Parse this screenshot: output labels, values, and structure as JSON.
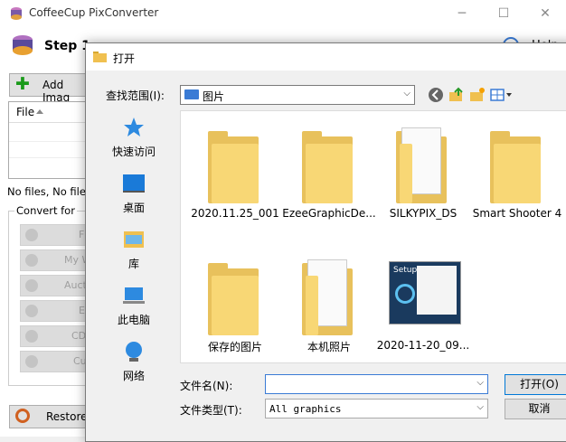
{
  "app": {
    "title": "CoffeeCup PixConverter",
    "window_controls": [
      "minimize",
      "maximize",
      "close"
    ]
  },
  "main": {
    "step_text": "Step 1",
    "help_label": "Help",
    "add_images_label": "Add Imag",
    "file_column_header": "File",
    "no_files_text": "No files, No files s",
    "convert_for_label": "Convert for",
    "convert_buttons": [
      {
        "label": "F",
        "icon": "film-icon"
      },
      {
        "label": "My W",
        "icon": "web-icon"
      },
      {
        "label": "Auct",
        "icon": "auction-icon"
      },
      {
        "label": "E",
        "icon": "email-icon"
      },
      {
        "label": "CD",
        "icon": "cd-icon"
      },
      {
        "label": "Cu",
        "icon": "custom-icon"
      }
    ],
    "restore_label": "Restore"
  },
  "dialog": {
    "title": "打开",
    "lookin_label": "查找范围(I):",
    "lookin_value": "图片",
    "places": [
      {
        "label": "快速访问",
        "icon": "quick-access-icon"
      },
      {
        "label": "桌面",
        "icon": "desktop-icon"
      },
      {
        "label": "库",
        "icon": "library-icon"
      },
      {
        "label": "此电脑",
        "icon": "this-pc-icon"
      },
      {
        "label": "网络",
        "icon": "network-icon"
      }
    ],
    "files": [
      {
        "name": "2020.11.25_001",
        "kind": "folder"
      },
      {
        "name": "EzeeGraphicDe...",
        "kind": "folder"
      },
      {
        "name": "SILKYPIX_DS",
        "kind": "folder-doc"
      },
      {
        "name": "Smart Shooter 4",
        "kind": "folder"
      },
      {
        "name": "保存的图片",
        "kind": "folder"
      },
      {
        "name": "本机照片",
        "kind": "folder-doc"
      },
      {
        "name": "2020-11-20_09...",
        "kind": "image"
      }
    ],
    "thumb_text": "Setup",
    "filename_label": "文件名(N):",
    "filename_value": "",
    "filetype_label": "文件类型(T):",
    "filetype_value": "All graphics",
    "open_button": "打开(O)",
    "cancel_button": "取消"
  },
  "colors": {
    "accent": "#0078d7",
    "folder": "#f8d775"
  }
}
